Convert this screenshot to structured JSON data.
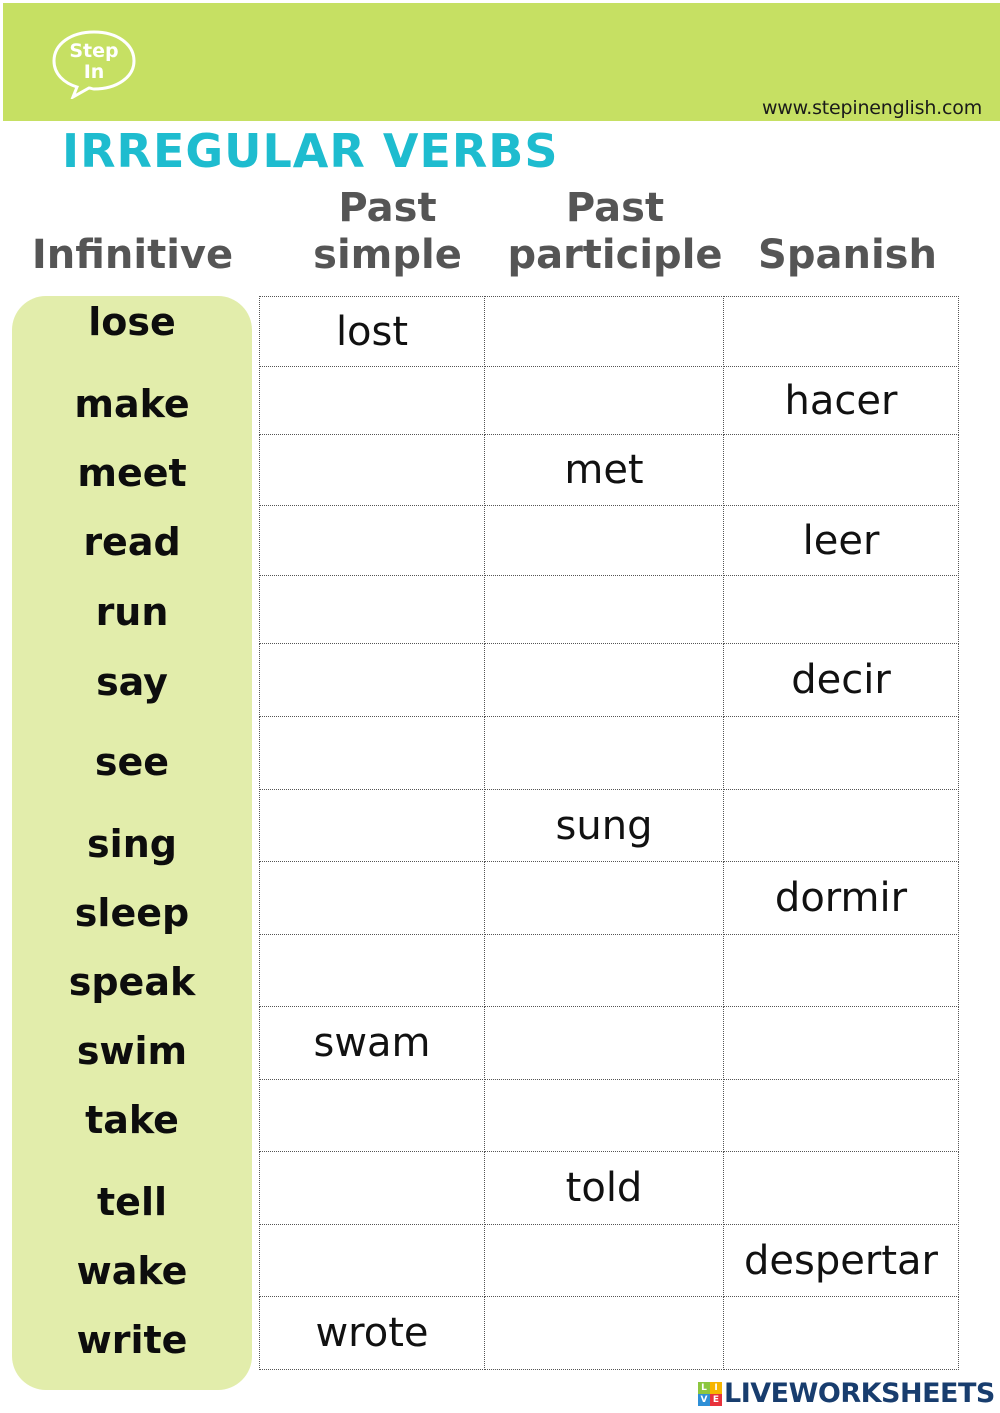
{
  "header": {
    "logo_line1": "Step",
    "logo_line2": "In",
    "site_url": "www.stepinenglish.com",
    "band_color": "#c6e063"
  },
  "title": "IRREGULAR VERBS",
  "columns": {
    "infinitive": "Infinitive",
    "past_simple_line1": "Past",
    "past_simple_line2": "simple",
    "past_participle_line1": "Past",
    "past_participle_line2": "participle",
    "spanish": "Spanish"
  },
  "verbs": [
    {
      "infinitive": "lose",
      "past_simple": "lost",
      "past_participle": "",
      "spanish": ""
    },
    {
      "infinitive": "make",
      "past_simple": "",
      "past_participle": "",
      "spanish": "hacer"
    },
    {
      "infinitive": "meet",
      "past_simple": "",
      "past_participle": "met",
      "spanish": ""
    },
    {
      "infinitive": "read",
      "past_simple": "",
      "past_participle": "",
      "spanish": "leer"
    },
    {
      "infinitive": "run",
      "past_simple": "",
      "past_participle": "",
      "spanish": ""
    },
    {
      "infinitive": "say",
      "past_simple": "",
      "past_participle": "",
      "spanish": "decir"
    },
    {
      "infinitive": "see",
      "past_simple": "",
      "past_participle": "",
      "spanish": ""
    },
    {
      "infinitive": "sing",
      "past_simple": "",
      "past_participle": "sung",
      "spanish": ""
    },
    {
      "infinitive": "sleep",
      "past_simple": "",
      "past_participle": "",
      "spanish": "dormir"
    },
    {
      "infinitive": "speak",
      "past_simple": "",
      "past_participle": "",
      "spanish": ""
    },
    {
      "infinitive": "swim",
      "past_simple": "swam",
      "past_participle": "",
      "spanish": ""
    },
    {
      "infinitive": "take",
      "past_simple": "",
      "past_participle": "",
      "spanish": ""
    },
    {
      "infinitive": "tell",
      "past_simple": "",
      "past_participle": "told",
      "spanish": ""
    },
    {
      "infinitive": "wake",
      "past_simple": "",
      "past_participle": "",
      "spanish": "despertar"
    },
    {
      "infinitive": "write",
      "past_simple": "wrote",
      "past_participle": "",
      "spanish": ""
    }
  ],
  "footer": {
    "brand_badge": [
      "L",
      "I",
      "V",
      "E"
    ],
    "brand": "LIVEWORKSHEETS"
  },
  "colors": {
    "title": "#1ebccf",
    "header_text": "#555555",
    "panel": "#e2edab",
    "brand": "#183d6e"
  }
}
